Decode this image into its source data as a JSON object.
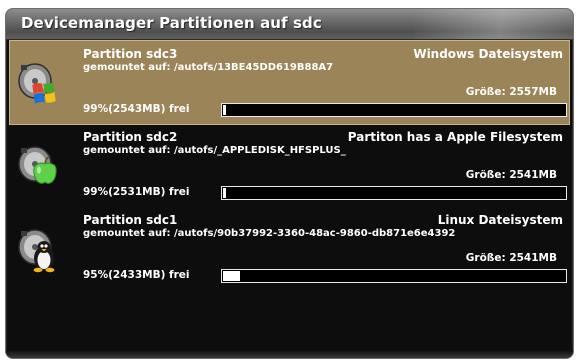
{
  "window": {
    "title": "Devicemanager Partitionen auf sdc"
  },
  "partitions": [
    {
      "name": "Partition sdc3",
      "fstype": "Windows Dateisystem",
      "mount": "gemountet auf: /autofs/13BE45DD619B88A7",
      "size": "Größe: 2557MB",
      "free": "99%(2543MB) frei",
      "used_fraction": 0.005,
      "icon": "windows-disk-icon",
      "selected": true
    },
    {
      "name": "Partition sdc2",
      "fstype": "Partiton has a Apple Filesystem",
      "mount": "gemountet auf: /autofs/_APPLEDISK_HFSPLUS_",
      "size": "Größe: 2541MB",
      "free": "99%(2531MB) frei",
      "used_fraction": 0.005,
      "icon": "apple-disk-icon",
      "selected": false
    },
    {
      "name": "Partition sdc1",
      "fstype": "Linux Dateisystem",
      "mount": "gemountet auf: /autofs/90b37992-3360-48ac-9860-db871e6e4392",
      "size": "Größe: 2541MB",
      "free": "95%(2433MB) frei",
      "used_fraction": 0.05,
      "icon": "linux-disk-icon",
      "selected": false
    }
  ],
  "colors": {
    "selected_row": "#9a8458",
    "text": "#ffffff",
    "background": "#0d0d0d"
  }
}
